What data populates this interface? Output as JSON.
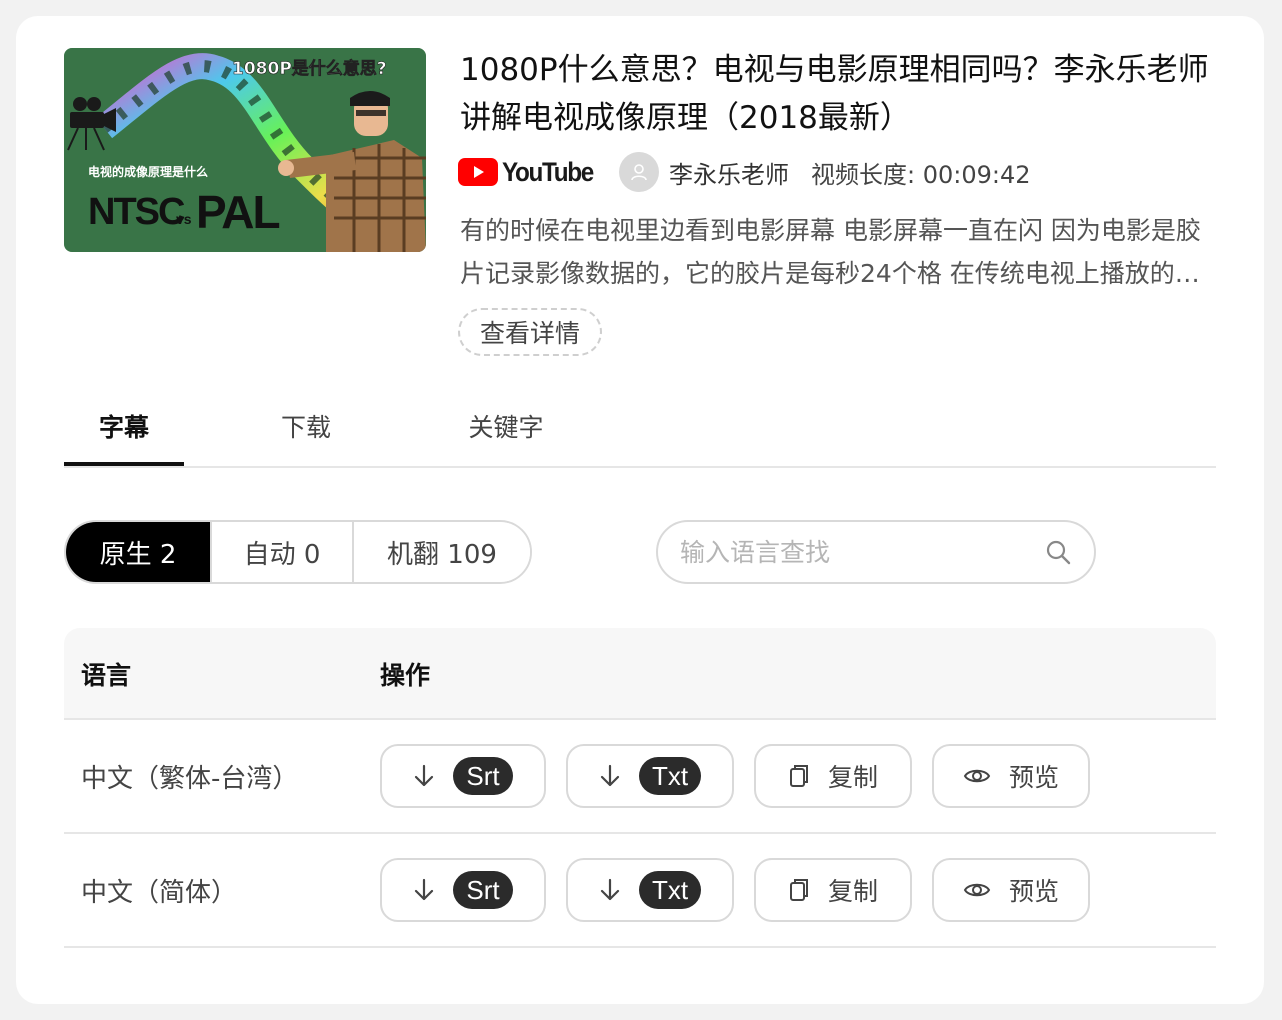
{
  "video": {
    "title": "1080P什么意思？电视与电影原理相同吗？李永乐老师讲解电视成像原理（2018最新）",
    "platform": "YouTube",
    "author": "李永乐老师",
    "duration": "视频长度: 00:09:42",
    "description": "有的时候在电视里边看到电影屏幕 电影屏幕一直在闪 因为电影是胶片记录影像数据的，它的胶片是每秒24个格 在传统电视上播放的时候需要进行转换",
    "details_label": "查看详情",
    "thumbnail": {
      "headline": "1080P是什么意思?",
      "subtitle": "电视的成像原理是什么",
      "ntsc": "NTSC",
      "vs": "vs",
      "pal": "PAL",
      "bg_color": "#3f7a4d"
    }
  },
  "tabs": [
    {
      "label": "字幕",
      "active": true
    },
    {
      "label": "下载",
      "active": false
    },
    {
      "label": "关键字",
      "active": false
    }
  ],
  "filters": [
    {
      "label": "原生 2",
      "active": true
    },
    {
      "label": "自动 0",
      "active": false
    },
    {
      "label": "机翻 109",
      "active": false
    }
  ],
  "search": {
    "placeholder": "输入语言查找",
    "value": ""
  },
  "table": {
    "headers": {
      "language": "语言",
      "actions": "操作"
    },
    "rows": [
      {
        "language": "中文（繁体-台湾）"
      },
      {
        "language": "中文（简体）"
      }
    ],
    "actions": {
      "srt": "Srt",
      "txt": "Txt",
      "copy": "复制",
      "preview": "预览"
    }
  },
  "colors": {
    "youtube_red": "#ff0000",
    "active_bg": "#000000",
    "pill_bg": "#2b2b2b",
    "border": "#d9d9d9"
  }
}
